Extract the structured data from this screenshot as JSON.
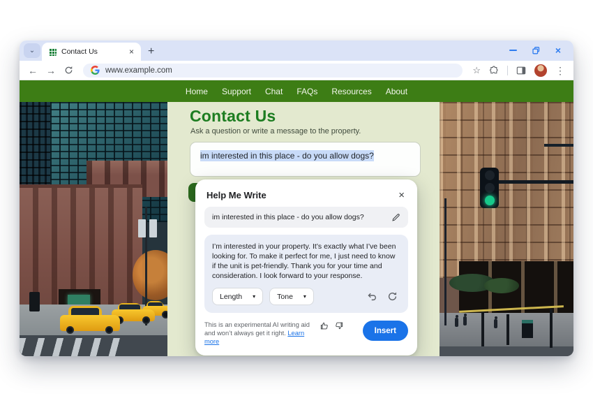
{
  "browser": {
    "tab_title": "Contact Us",
    "url": "www.example.com",
    "icons": {
      "tab_search_chevron": "⌄",
      "tab_close": "×",
      "new_tab": "+",
      "back": "←",
      "forward": "→",
      "star": "☆",
      "kebab": "⋮",
      "window_close": "×",
      "dialog_close": "×",
      "dropdown_caret": "▾"
    }
  },
  "nav": {
    "items": [
      "Home",
      "Support",
      "Chat",
      "FAQs",
      "Resources",
      "About"
    ]
  },
  "page": {
    "title": "Contact Us",
    "subtitle": "Ask a question or write a message to the property.",
    "message": "im interested in this place - do you allow dogs?"
  },
  "dialog": {
    "title": "Help Me Write",
    "prompt": "im interested in this place - do you allow dogs?",
    "generated_text": "I’m interested in your property. It’s exactly what I’ve been looking for. To make it perfect for me, I just need to know if the unit is pet-friendly. Thank you for your time and consideration. I look forward to your response.",
    "length_label": "Length",
    "tone_label": "Tone",
    "disclaimer": "This is an experimental AI writing aid and won’t always get it right. ",
    "learn_more_label": "Learn more",
    "insert_label": "Insert"
  },
  "colors": {
    "nav_green": "#3d7d15",
    "heading_green": "#1d7d21",
    "page_bg": "#e3e9cf",
    "insert_blue": "#1a73e8",
    "selection_highlight": "#c8dbf8",
    "tabstrip_bg": "#dbe3f7"
  }
}
